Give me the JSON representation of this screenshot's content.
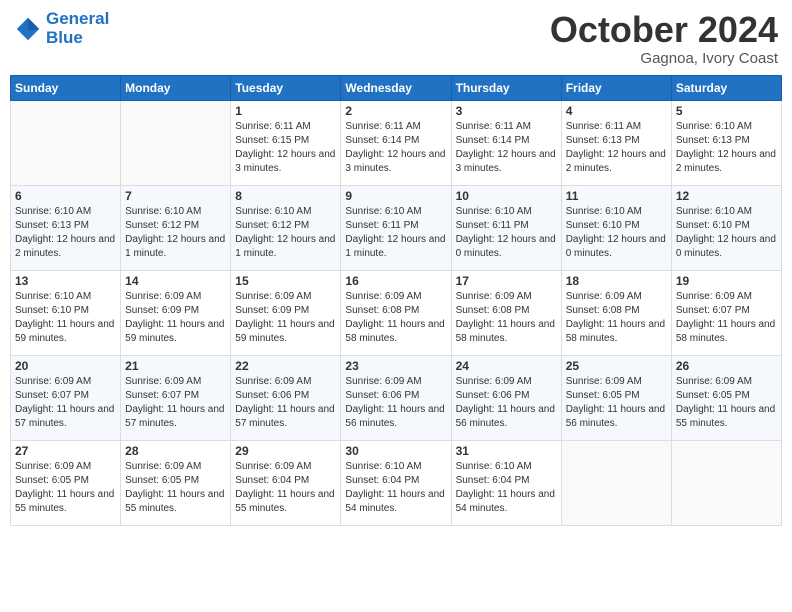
{
  "header": {
    "logo_line1": "General",
    "logo_line2": "Blue",
    "month": "October 2024",
    "location": "Gagnoa, Ivory Coast"
  },
  "weekdays": [
    "Sunday",
    "Monday",
    "Tuesday",
    "Wednesday",
    "Thursday",
    "Friday",
    "Saturday"
  ],
  "weeks": [
    [
      {
        "day": "",
        "info": ""
      },
      {
        "day": "",
        "info": ""
      },
      {
        "day": "1",
        "info": "Sunrise: 6:11 AM\nSunset: 6:15 PM\nDaylight: 12 hours and 3 minutes."
      },
      {
        "day": "2",
        "info": "Sunrise: 6:11 AM\nSunset: 6:14 PM\nDaylight: 12 hours and 3 minutes."
      },
      {
        "day": "3",
        "info": "Sunrise: 6:11 AM\nSunset: 6:14 PM\nDaylight: 12 hours and 3 minutes."
      },
      {
        "day": "4",
        "info": "Sunrise: 6:11 AM\nSunset: 6:13 PM\nDaylight: 12 hours and 2 minutes."
      },
      {
        "day": "5",
        "info": "Sunrise: 6:10 AM\nSunset: 6:13 PM\nDaylight: 12 hours and 2 minutes."
      }
    ],
    [
      {
        "day": "6",
        "info": "Sunrise: 6:10 AM\nSunset: 6:13 PM\nDaylight: 12 hours and 2 minutes."
      },
      {
        "day": "7",
        "info": "Sunrise: 6:10 AM\nSunset: 6:12 PM\nDaylight: 12 hours and 1 minute."
      },
      {
        "day": "8",
        "info": "Sunrise: 6:10 AM\nSunset: 6:12 PM\nDaylight: 12 hours and 1 minute."
      },
      {
        "day": "9",
        "info": "Sunrise: 6:10 AM\nSunset: 6:11 PM\nDaylight: 12 hours and 1 minute."
      },
      {
        "day": "10",
        "info": "Sunrise: 6:10 AM\nSunset: 6:11 PM\nDaylight: 12 hours and 0 minutes."
      },
      {
        "day": "11",
        "info": "Sunrise: 6:10 AM\nSunset: 6:10 PM\nDaylight: 12 hours and 0 minutes."
      },
      {
        "day": "12",
        "info": "Sunrise: 6:10 AM\nSunset: 6:10 PM\nDaylight: 12 hours and 0 minutes."
      }
    ],
    [
      {
        "day": "13",
        "info": "Sunrise: 6:10 AM\nSunset: 6:10 PM\nDaylight: 11 hours and 59 minutes."
      },
      {
        "day": "14",
        "info": "Sunrise: 6:09 AM\nSunset: 6:09 PM\nDaylight: 11 hours and 59 minutes."
      },
      {
        "day": "15",
        "info": "Sunrise: 6:09 AM\nSunset: 6:09 PM\nDaylight: 11 hours and 59 minutes."
      },
      {
        "day": "16",
        "info": "Sunrise: 6:09 AM\nSunset: 6:08 PM\nDaylight: 11 hours and 58 minutes."
      },
      {
        "day": "17",
        "info": "Sunrise: 6:09 AM\nSunset: 6:08 PM\nDaylight: 11 hours and 58 minutes."
      },
      {
        "day": "18",
        "info": "Sunrise: 6:09 AM\nSunset: 6:08 PM\nDaylight: 11 hours and 58 minutes."
      },
      {
        "day": "19",
        "info": "Sunrise: 6:09 AM\nSunset: 6:07 PM\nDaylight: 11 hours and 58 minutes."
      }
    ],
    [
      {
        "day": "20",
        "info": "Sunrise: 6:09 AM\nSunset: 6:07 PM\nDaylight: 11 hours and 57 minutes."
      },
      {
        "day": "21",
        "info": "Sunrise: 6:09 AM\nSunset: 6:07 PM\nDaylight: 11 hours and 57 minutes."
      },
      {
        "day": "22",
        "info": "Sunrise: 6:09 AM\nSunset: 6:06 PM\nDaylight: 11 hours and 57 minutes."
      },
      {
        "day": "23",
        "info": "Sunrise: 6:09 AM\nSunset: 6:06 PM\nDaylight: 11 hours and 56 minutes."
      },
      {
        "day": "24",
        "info": "Sunrise: 6:09 AM\nSunset: 6:06 PM\nDaylight: 11 hours and 56 minutes."
      },
      {
        "day": "25",
        "info": "Sunrise: 6:09 AM\nSunset: 6:05 PM\nDaylight: 11 hours and 56 minutes."
      },
      {
        "day": "26",
        "info": "Sunrise: 6:09 AM\nSunset: 6:05 PM\nDaylight: 11 hours and 55 minutes."
      }
    ],
    [
      {
        "day": "27",
        "info": "Sunrise: 6:09 AM\nSunset: 6:05 PM\nDaylight: 11 hours and 55 minutes."
      },
      {
        "day": "28",
        "info": "Sunrise: 6:09 AM\nSunset: 6:05 PM\nDaylight: 11 hours and 55 minutes."
      },
      {
        "day": "29",
        "info": "Sunrise: 6:09 AM\nSunset: 6:04 PM\nDaylight: 11 hours and 55 minutes."
      },
      {
        "day": "30",
        "info": "Sunrise: 6:10 AM\nSunset: 6:04 PM\nDaylight: 11 hours and 54 minutes."
      },
      {
        "day": "31",
        "info": "Sunrise: 6:10 AM\nSunset: 6:04 PM\nDaylight: 11 hours and 54 minutes."
      },
      {
        "day": "",
        "info": ""
      },
      {
        "day": "",
        "info": ""
      }
    ]
  ]
}
